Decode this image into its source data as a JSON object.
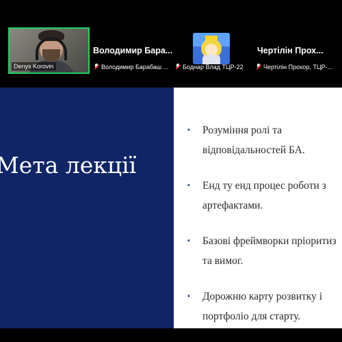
{
  "participants": {
    "video_tile": {
      "name": "Denys Korovin"
    },
    "tile2": {
      "display_name": "Володимир  Бара...",
      "label": "Володимир Барабаш ..."
    },
    "tile3": {
      "label": "Боднар Влад ТЦР-22"
    },
    "tile4": {
      "display_name": "Чертілін  Прох...",
      "label": "Чертілін Прохор, ТЦР-..."
    }
  },
  "slide": {
    "title": "Мета лекції",
    "bullets": [
      {
        "line1": "Розуміння ролі та",
        "line2": "відповідальностей БА."
      },
      {
        "line1": "Енд ту енд процес роботи з",
        "line2": "артефактами."
      },
      {
        "line1": "Базові фреймворки пріоритиз",
        "line2": "та вимог."
      },
      {
        "line1": "Дорожню карту розвитку і",
        "line2": "портфоліо для старту."
      }
    ]
  },
  "colors": {
    "slide_left_bg": "#102566",
    "active_speaker_border": "#23d160",
    "muted_icon": "#e02828"
  }
}
